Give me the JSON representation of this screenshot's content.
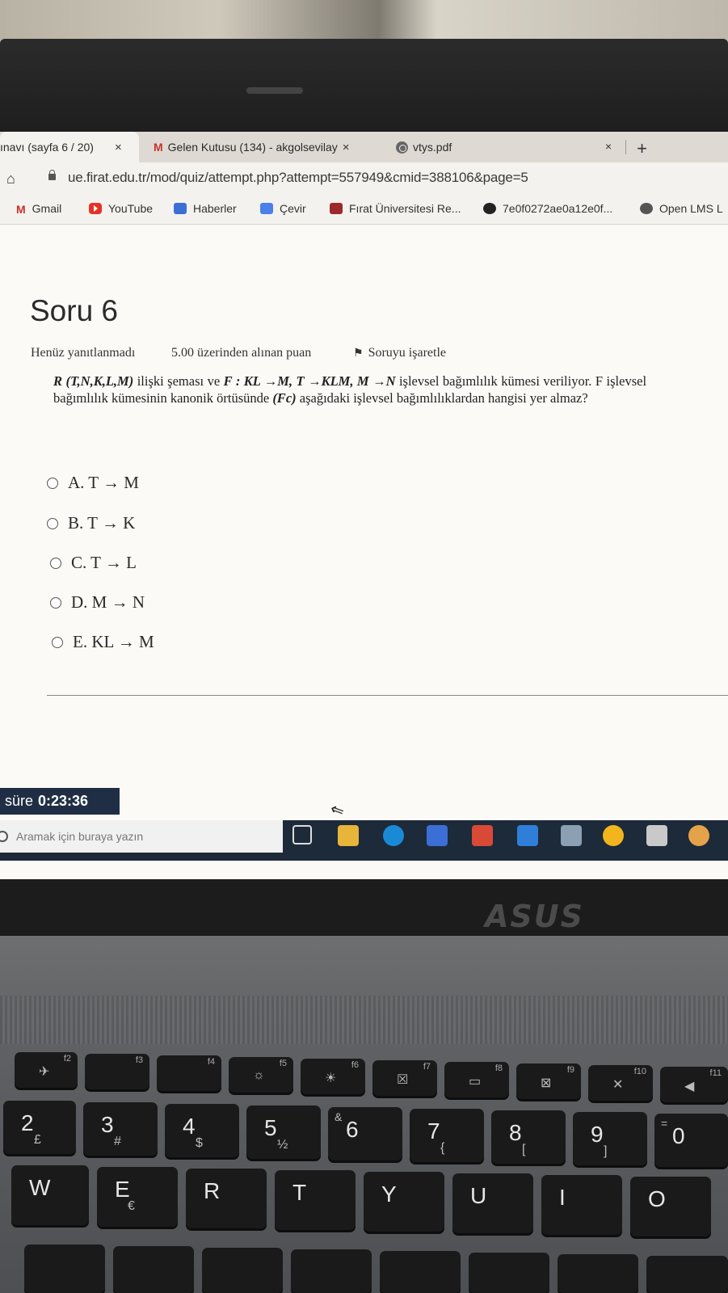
{
  "tabs": [
    {
      "label": "ınavı (sayfa 6 / 20)",
      "close": "×"
    },
    {
      "label": "Gelen Kutusu (134) - akgolsevilay",
      "close": "×"
    },
    {
      "label": "vtys.pdf",
      "close": "×"
    }
  ],
  "new_tab": "+",
  "address": {
    "url": "ue.firat.edu.tr/mod/quiz/attempt.php?attempt=557949&cmid=388106&page=5"
  },
  "bookmarks": [
    {
      "label": "Gmail"
    },
    {
      "label": "YouTube"
    },
    {
      "label": "Haberler"
    },
    {
      "label": "Çevir"
    },
    {
      "label": "Fırat Üniversitesi Re..."
    },
    {
      "label": "7e0f0272ae0a12e0f..."
    },
    {
      "label": "Open LMS L"
    }
  ],
  "question": {
    "title": "Soru 6",
    "status": "Henüz yanıtlanmadı",
    "points": "5.00 üzerinden alınan puan",
    "flag": "Soruyu işaretle",
    "text_bold": "R (T,N,K,L,M)",
    "text_1": "ilişki şeması ve",
    "text_bold2": "F : KL →M, T →KLM, M →N",
    "text_2": "işlevsel bağımlılık kümesi veriliyor. F işlevsel bağımlılık kümesinin kanonik örtüsünde",
    "text_bold3": "(Fc)",
    "text_3": "aşağıdaki işlevsel bağımlılıklardan hangisi yer almaz?",
    "options": [
      {
        "label": "A. T → M"
      },
      {
        "label": "B. T → K"
      },
      {
        "label": "C. T → L"
      },
      {
        "label": "D. M → N"
      },
      {
        "label": "E. KL → M"
      }
    ]
  },
  "timer": {
    "label": "süre",
    "value": "0:23:36"
  },
  "taskbar": {
    "search_placeholder": "Aramak için buraya yazın"
  },
  "brand": "ASUS",
  "keyboard": {
    "fkeys": [
      "f2",
      "f3",
      "f4",
      "f5",
      "f6",
      "f7",
      "f8",
      "f9",
      "f10",
      "f11"
    ],
    "number_row": [
      {
        "main": "2",
        "sub": "£"
      },
      {
        "main": "3",
        "sub": "#"
      },
      {
        "main": "4",
        "sub": "$"
      },
      {
        "main": "5",
        "sub": "½"
      },
      {
        "main": "6",
        "sub": "&"
      },
      {
        "main": "7",
        "sub": "{"
      },
      {
        "main": "8",
        "sub": "["
      },
      {
        "main": "9",
        "sub": "]"
      },
      {
        "main": "0",
        "sub": "="
      }
    ],
    "letter_row": [
      {
        "main": "W"
      },
      {
        "main": "E",
        "sub": "€"
      },
      {
        "main": "R"
      },
      {
        "main": "T"
      },
      {
        "main": "Y"
      },
      {
        "main": "U"
      },
      {
        "main": "I"
      },
      {
        "main": "O"
      }
    ]
  }
}
